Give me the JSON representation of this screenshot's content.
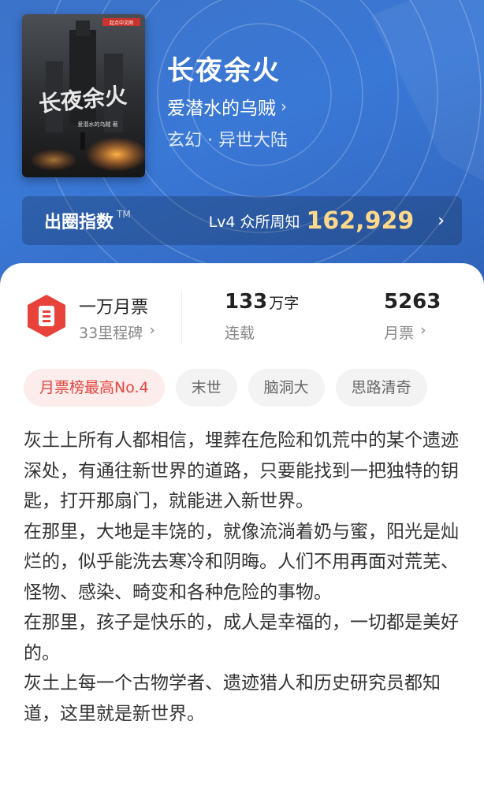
{
  "book": {
    "title": "长夜余火",
    "author": "爱潜水的乌贼",
    "genre": "玄幻 · 异世大陆",
    "cover": {
      "title": "长夜余火",
      "author_line": "爱潜水的乌贼 著",
      "publisher": "起点中文网"
    }
  },
  "circle_index": {
    "label": "出圈指数",
    "tm": "TM",
    "level": "Lv4 众所周知",
    "value": "162,929"
  },
  "stats": {
    "badge_main": "一万月票",
    "badge_sub": "33里程碑",
    "words_value": "133",
    "words_unit": "万字",
    "words_label": "连载",
    "tickets_value": "5263",
    "tickets_label": "月票"
  },
  "tags": [
    "月票榜最高No.4",
    "末世",
    "脑洞大",
    "思路清奇"
  ],
  "synopsis": [
    "灰土上所有人都相信，埋葬在危险和饥荒中的某个遗迹深处，有通往新世界的道路，只要能找到一把独特的钥匙，打开那扇门，就能进入新世界。",
    "在那里，大地是丰饶的，就像流淌着奶与蜜，阳光是灿烂的，似乎能洗去寒冷和阴晦。人们不用再面对荒芜、怪物、感染、畸变和各种危险的事物。",
    "在那里，孩子是快乐的，成人是幸福的，一切都是美好的。",
    "灰土上每一个古物学者、遗迹猎人和历史研究员都知道，这里就是新世界。"
  ],
  "colors": {
    "hero_blue": "#3a78d6",
    "accent_gold": "#ffd98a",
    "badge_red": "#e8433a"
  }
}
